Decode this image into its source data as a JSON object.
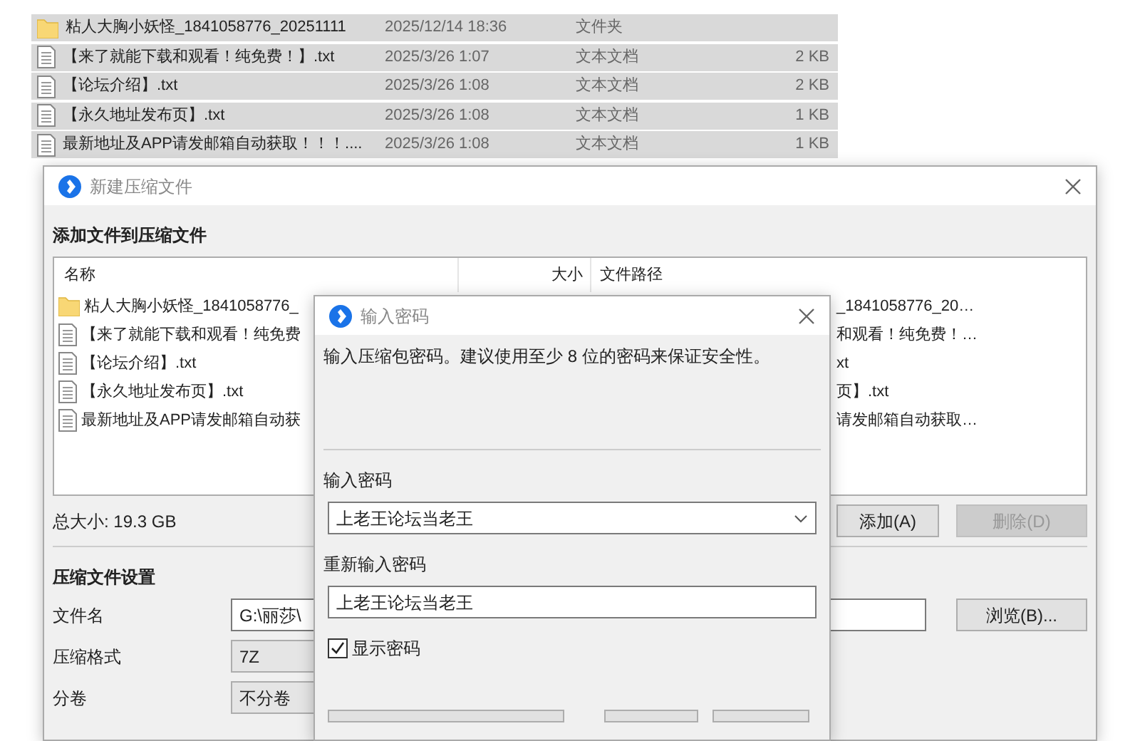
{
  "explorer": {
    "rows": [
      {
        "kind": "folder",
        "name": "粘人大胸小妖怪_1841058776_20251111",
        "date": "2025/12/14 18:36",
        "type": "文件夹",
        "selected": true
      },
      {
        "kind": "text",
        "name": "【来了就能下载和观看！纯免费！】.txt",
        "date": "2025/3/26 1:07",
        "type": "文本文档",
        "size": "2 KB",
        "selected": true
      },
      {
        "kind": "text",
        "name": "【论坛介绍】.txt",
        "date": "2025/3/26 1:08",
        "type": "文本文档",
        "size": "2 KB",
        "selected": true
      },
      {
        "kind": "text",
        "name": "【永久地址发布页】.txt",
        "date": "2025/3/26 1:08",
        "type": "文本文档",
        "size": "1 KB",
        "selected": true
      },
      {
        "kind": "text",
        "name": "最新地址及APP请发邮箱自动获取！！！....",
        "date": "2025/3/26 1:08",
        "type": "文本文档",
        "size": "1 KB",
        "selected": true
      }
    ]
  },
  "main_dialog": {
    "title": "新建压缩文件",
    "heading": "添加文件到压缩文件",
    "file_list": {
      "columns": [
        "名称",
        "大小",
        "文件路径"
      ],
      "rows": [
        {
          "kind": "folder",
          "name": "粘人大胸小妖怪_1841058776_",
          "path": "_1841058776_20…"
        },
        {
          "kind": "text",
          "name": "【来了就能下载和观看！纯免费",
          "path": "和观看！纯免费！…"
        },
        {
          "kind": "text",
          "name": "【论坛介绍】.txt",
          "path": "xt"
        },
        {
          "kind": "text",
          "name": "【永久地址发布页】.txt",
          "path": "页】.txt"
        },
        {
          "kind": "text",
          "name": "最新地址及APP请发邮箱自动获",
          "path": "请发邮箱自动获取…"
        }
      ]
    },
    "total_size": "总大小: 19.3 GB",
    "buttons": [
      {
        "label": "添加(A)",
        "disabled": false
      },
      {
        "label": "删除(D)",
        "disabled": true
      }
    ],
    "settings_heading": "压缩文件设置",
    "settings": [
      {
        "kind": "text",
        "label": "文件名",
        "value": "G:\\丽莎\\",
        "button": "浏览(B)..."
      },
      {
        "kind": "select",
        "label": "压缩格式",
        "value": "7Z"
      },
      {
        "kind": "select",
        "label": "分卷",
        "value": "不分卷"
      }
    ]
  },
  "password_dialog": {
    "title": "输入密码",
    "message": "输入压缩包密码。建议使用至少 8 位的密码来保证安全性。",
    "password_label": "输入密码",
    "password_value": "上老王论坛当老王",
    "confirm_label": "重新输入密码",
    "confirm_value": "上老王论坛当老王",
    "show_password": {
      "label": "显示密码",
      "checked": true
    }
  }
}
